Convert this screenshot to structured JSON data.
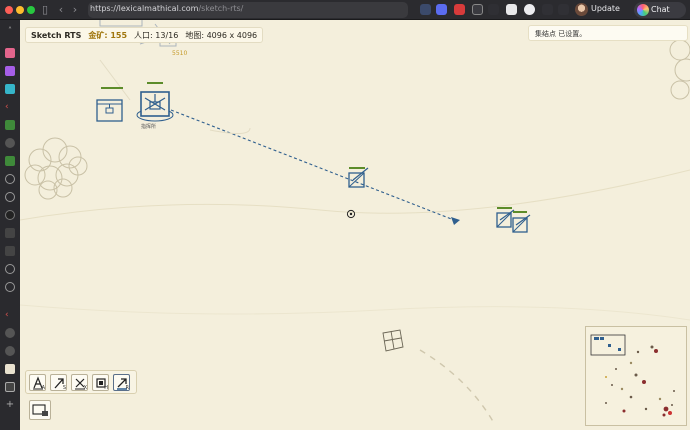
{
  "browser": {
    "url_host": "https://lexicalmathical.com",
    "url_path": "/sketch-rts/",
    "update_label": "Update",
    "chat_label": "Chat"
  },
  "hud": {
    "title": "Sketch RTS",
    "gold_label": "金矿: 155",
    "population_label": "人口: 13/16",
    "map_label": "地图: 4096 x 4096"
  },
  "toast": {
    "message": "集结点 已设置。"
  },
  "world": {
    "selected_building_label": "指挥所",
    "faded_label": "5510"
  },
  "command_bar": {
    "buttons": [
      {
        "icon": "attack-icon",
        "hotkey": "A"
      },
      {
        "icon": "move-icon",
        "hotkey": "S"
      },
      {
        "icon": "stop-icon",
        "hotkey": "X"
      },
      {
        "icon": "hold-icon",
        "hotkey": "H"
      },
      {
        "icon": "rally-icon",
        "hotkey": "R"
      }
    ]
  },
  "colors": {
    "ground": "#f4efdc",
    "unit_blue": "#2f5f8e",
    "health_green": "#5c8c2a"
  }
}
